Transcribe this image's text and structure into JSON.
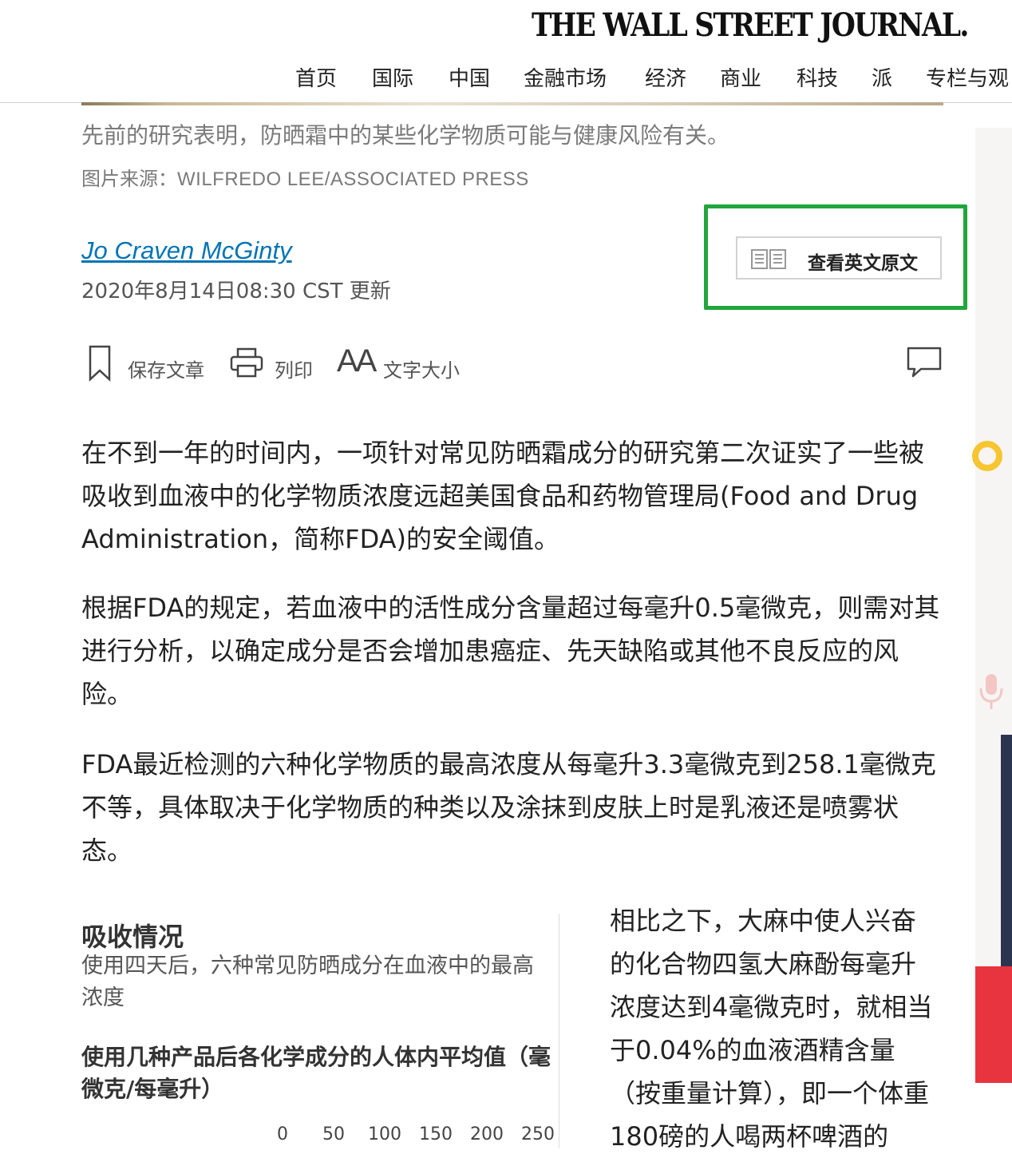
{
  "header": {
    "masthead": "THE WALL STREET JOURNAL.",
    "nav": [
      {
        "label": "首页"
      },
      {
        "label": "国际"
      },
      {
        "label": "中国"
      },
      {
        "label": "金融市场"
      },
      {
        "label": "经济"
      },
      {
        "label": "商业"
      },
      {
        "label": "科技"
      },
      {
        "label": "派"
      },
      {
        "label": "专栏与观"
      }
    ]
  },
  "image": {
    "caption": "先前的研究表明，防晒霜中的某些化学物质可能与健康风险有关。",
    "credit_label": "图片来源：",
    "credit_name": "WILFREDO LEE/ASSOCIATED PRESS"
  },
  "byline": {
    "author": "Jo Craven McGinty",
    "timestamp": "2020年8月14日08:30 CST 更新"
  },
  "view_english": {
    "label": "查看英文原文",
    "highlight_color": "#21a63c"
  },
  "tools": {
    "save_label": "保存文章",
    "print_label": "列印",
    "font_size_label": "文字大小",
    "font_size_glyph": "AA"
  },
  "article": {
    "paragraphs": [
      "在不到一年的时间内，一项针对常见防晒霜成分的研究第二次证实了一些被吸收到血液中的化学物质浓度远超美国食品和药物管理局(Food and Drug Administration，简称FDA)的安全阈值。",
      "根据FDA的规定，若血液中的活性成分含量超过每毫升0.5毫微克，则需对其进行分析，以确定成分是否会增加患癌症、先天缺陷或其他不良反应的风险。",
      "FDA最近检测的六种化学物质的最高浓度从每毫升3.3毫微克到258.1毫微克不等，具体取决于化学物质的种类以及涂抹到皮肤上时是乳液还是喷雾状态。"
    ],
    "side_paragraph": "相比之下，大麻中使人兴奋的化合物四氢大麻酚每毫升浓度达到4毫微克时，就相当于0.04%的血液酒精含量（按重量计算），即一个体重180磅的人喝两杯啤酒的"
  },
  "chart_data": {
    "type": "bar",
    "title": "吸收情况",
    "subtitle": "使用四天后，六种常见防晒成分在血液中的最高浓度",
    "heading": "使用几种产品后各化学成分的人体内平均值（毫微克/每毫升）",
    "x_ticks": [
      "0",
      "50",
      "100",
      "150",
      "200",
      "250"
    ],
    "xlim": [
      0,
      250
    ]
  },
  "colors": {
    "link": "#0274b6",
    "ad_accent_red": "#e8343f",
    "ad_accent_yellow": "#f6c531"
  }
}
